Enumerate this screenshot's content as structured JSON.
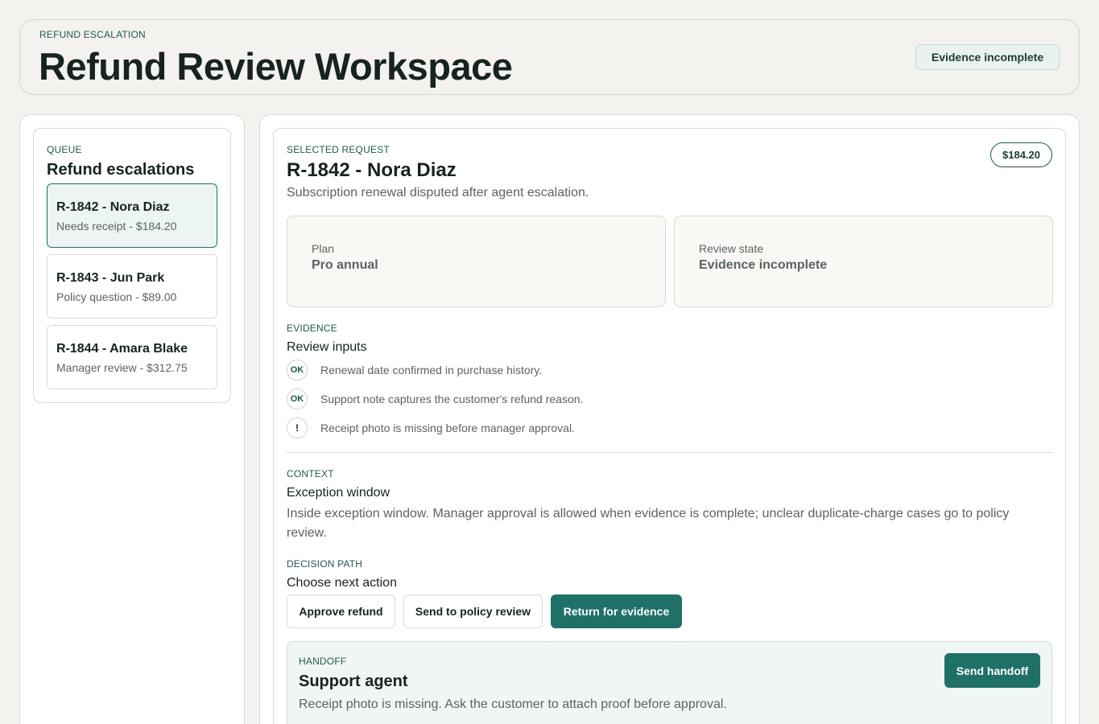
{
  "header": {
    "eyebrow": "REFUND ESCALATION",
    "title": "Refund Review Workspace",
    "status_badge": "Evidence incomplete"
  },
  "queue": {
    "eyebrow": "QUEUE",
    "title": "Refund escalations",
    "items": [
      {
        "title": "R-1842 - Nora Diaz",
        "subtitle": "Needs receipt - $184.20",
        "selected": true
      },
      {
        "title": "R-1843 - Jun Park",
        "subtitle": "Policy question - $89.00",
        "selected": false
      },
      {
        "title": "R-1844 - Amara Blake",
        "subtitle": "Manager review - $312.75",
        "selected": false
      }
    ]
  },
  "request": {
    "eyebrow": "SELECTED REQUEST",
    "title": "R-1842 - Nora Diaz",
    "subtitle": "Subscription renewal disputed after agent escalation.",
    "amount": "$184.20",
    "plan_label": "Plan",
    "plan_value": "Pro annual",
    "state_label": "Review state",
    "state_value": "Evidence incomplete"
  },
  "evidence": {
    "eyebrow": "EVIDENCE",
    "title": "Review inputs",
    "items": [
      {
        "badge": "OK",
        "text": "Renewal date confirmed in purchase history.",
        "icon": "check-icon"
      },
      {
        "badge": "OK",
        "text": "Support note captures the customer's refund reason.",
        "icon": "check-icon"
      },
      {
        "badge": "!",
        "text": "Receipt photo is missing before manager approval.",
        "icon": "warning-icon"
      }
    ]
  },
  "context": {
    "eyebrow": "CONTEXT",
    "title": "Exception window",
    "text": "Inside exception window. Manager approval is allowed when evidence is complete; unclear duplicate-charge cases go to policy review."
  },
  "decision": {
    "eyebrow": "DECISION PATH",
    "title": "Choose next action",
    "approve_label": "Approve refund",
    "policy_label": "Send to policy review",
    "return_label": "Return for evidence"
  },
  "handoff": {
    "eyebrow": "HANDOFF",
    "title": "Support agent",
    "text": "Receipt photo is missing. Ask the customer to attach proof before approval.",
    "button_label": "Send handoff"
  }
}
